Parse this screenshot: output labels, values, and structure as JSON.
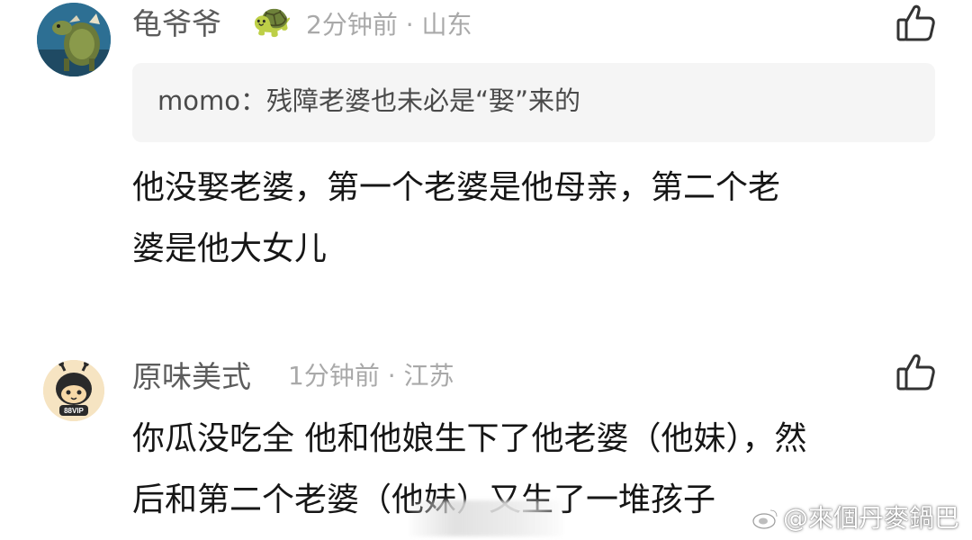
{
  "comments": [
    {
      "username": "龟爷爷",
      "badge_emoji": "🐢",
      "meta": "2分钟前 · 山东",
      "quote": {
        "author": "momo",
        "separator": "：",
        "text": "残障老婆也未必是“娶”来的"
      },
      "body_lines": [
        "他没娶老婆，第一个老婆是他母亲，第二个老",
        "婆是他大女儿"
      ],
      "avatar_icon": "turtle-illustration-avatar",
      "like_icon": "thumbs-up-icon"
    },
    {
      "username": "原味美式",
      "meta": "1分钟前 · 江苏",
      "avatar_badge": "88VIP",
      "body_lines": [
        "你瓜没吃全 他和他娘生下了他老婆（他妹），然",
        "后和第二个老婆（他妹）又生了一堆孩子"
      ],
      "avatar_icon": "cartoon-bee-avatar",
      "like_icon": "thumbs-up-icon"
    }
  ],
  "watermark": {
    "icon": "weibo-logo-icon",
    "text": "@來個丹麥鍋巴"
  },
  "colors": {
    "username": "#5c5c5c",
    "meta": "#a9a9a9",
    "body": "#161616",
    "quote_bg": "#f5f5f5"
  }
}
